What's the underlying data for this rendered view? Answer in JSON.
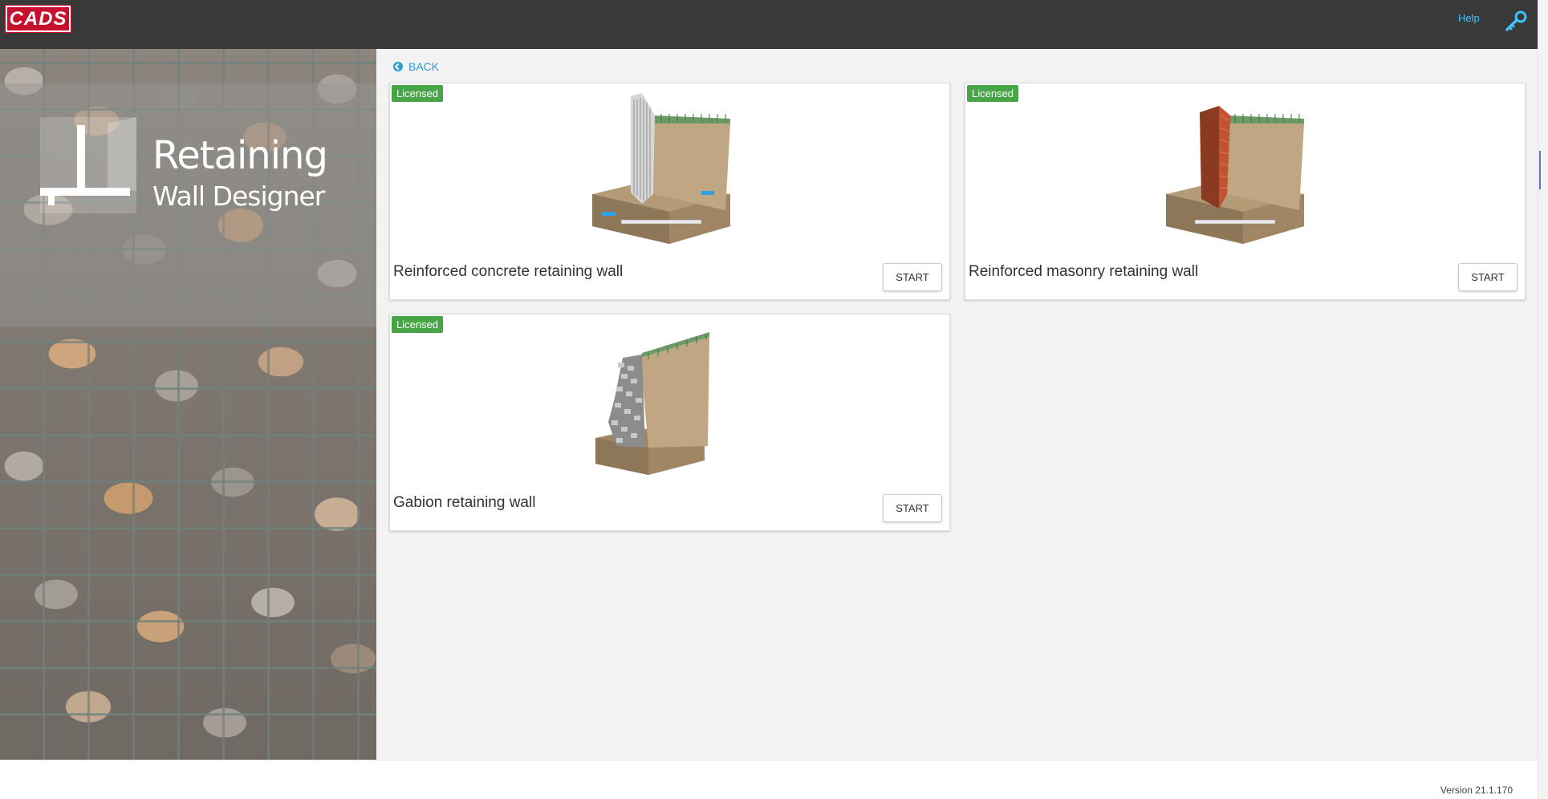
{
  "header": {
    "logo_text": "CADS",
    "help_label": "Help",
    "icons": {
      "settings": "key-wrench-icon"
    },
    "colors": {
      "background": "#393939",
      "link": "#3ec3ff",
      "logo": "#c8102e"
    }
  },
  "sidebar": {
    "title_line1": "Retaining",
    "title_line2": "Wall Designer",
    "logo_icon": "retaining-wall-logo-icon"
  },
  "main": {
    "back_label": "BACK",
    "cards": [
      {
        "badge": "Licensed",
        "title": "Reinforced concrete retaining wall",
        "button": "START",
        "image": "reinforced-concrete-wall-illustration"
      },
      {
        "badge": "Licensed",
        "title": "Reinforced masonry retaining wall",
        "button": "START",
        "image": "reinforced-masonry-wall-illustration"
      },
      {
        "badge": "Licensed",
        "title": "Gabion retaining wall",
        "button": "START",
        "image": "gabion-wall-illustration"
      }
    ],
    "colors": {
      "badge": "#47a447",
      "back_link": "#2b9fd1"
    }
  },
  "footer": {
    "version": "Version 21.1.170"
  }
}
